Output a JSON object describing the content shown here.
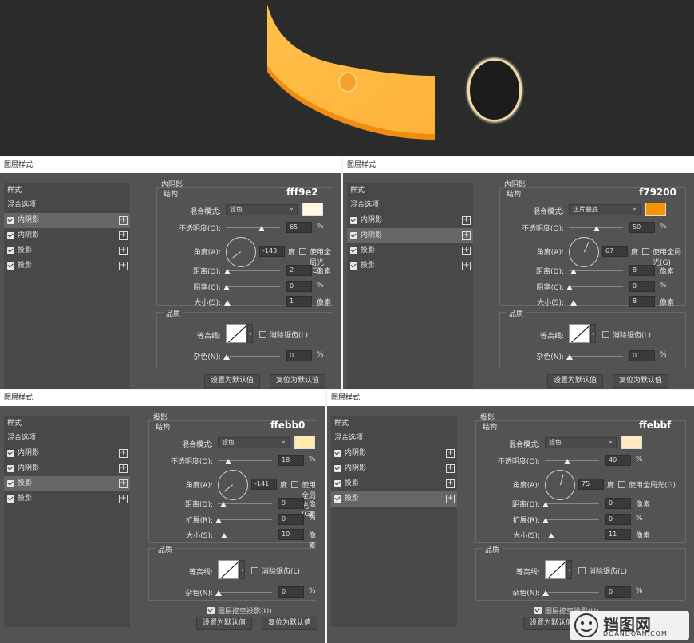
{
  "dialog_title": "图层样式",
  "left": {
    "header": "样式",
    "blend": "混合选项",
    "items": [
      "内阴影",
      "内阴影",
      "投影",
      "投影"
    ]
  },
  "labels": {
    "struct": "结构",
    "blend_mode": "混合模式:",
    "opacity": "不透明度(O):",
    "angle": "角度(A):",
    "degree": "度",
    "global": "使用全局光(G)",
    "distance": "距离(D):",
    "choke": "阻塞(C):",
    "spread": "扩展(R):",
    "size": "大小(S):",
    "quality": "品质",
    "contour": "等高线:",
    "antialias": "消除锯齿(L)",
    "noise": "杂色(N):",
    "pct": "%",
    "px": "像素",
    "knockout": "图层挖空投影(U)",
    "set_default": "设置为默认值",
    "reset_default": "复位为默认值"
  },
  "panels": [
    {
      "section": "内阴影",
      "hex": "fff9e2",
      "color": "#fff9e2",
      "mode": "滤色",
      "opacity": "65",
      "angle": "-143",
      "distance": "2",
      "second": "0",
      "size": "1",
      "noise": "0",
      "selected": 0
    },
    {
      "section": "内阴影",
      "hex": "f79200",
      "color": "#f79200",
      "mode": "正片叠底",
      "opacity": "50",
      "angle": "67",
      "distance": "8",
      "second": "0",
      "size": "8",
      "noise": "0",
      "selected": 1
    },
    {
      "section": "投影",
      "hex": "ffebb0",
      "color": "#ffebb0",
      "mode": "滤色",
      "opacity": "18",
      "angle": "-141",
      "distance": "9",
      "second": "0",
      "size": "10",
      "noise": "0",
      "selected": 2
    },
    {
      "section": "投影",
      "hex": "ffebbf",
      "color": "#ffebbf",
      "mode": "滤色",
      "opacity": "40",
      "angle": "75",
      "distance": "0",
      "second": "0",
      "size": "11",
      "noise": "0",
      "selected": 3
    }
  ],
  "watermark": {
    "brand": "铛图网",
    "url": "DOANDOAN.COM"
  }
}
